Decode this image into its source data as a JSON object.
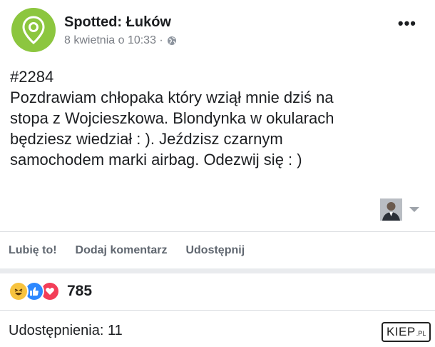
{
  "page": {
    "name": "Spotted: Łuków",
    "date": "8 kwietnia o 10:33 ·",
    "more_label": "•••"
  },
  "post": {
    "lines": [
      "#2284",
      "Pozdrawiam chłopaka który wziął mnie dziś na",
      "stopa z Wojcieszkowa. Blondynka w okularach",
      "będziesz wiedział : ). Jeździsz czarnym",
      "samochodem marki airbag. Odezwij się : )"
    ]
  },
  "actions": {
    "like": "Lubię to!",
    "comment": "Dodaj komentarz",
    "share": "Udostępnij"
  },
  "reactions": {
    "icons": [
      "haha-icon",
      "like-icon",
      "love-icon"
    ],
    "count": "785"
  },
  "shares": {
    "text": "Udostępnienia: 11"
  },
  "watermark": {
    "main": "KIEP",
    "sub": ".PL"
  },
  "colors": {
    "avatar": "#8cc63f",
    "like": "#2d88ff",
    "love": "#f33e58",
    "haha": "#f7c33f",
    "muted_text": "#606770"
  }
}
